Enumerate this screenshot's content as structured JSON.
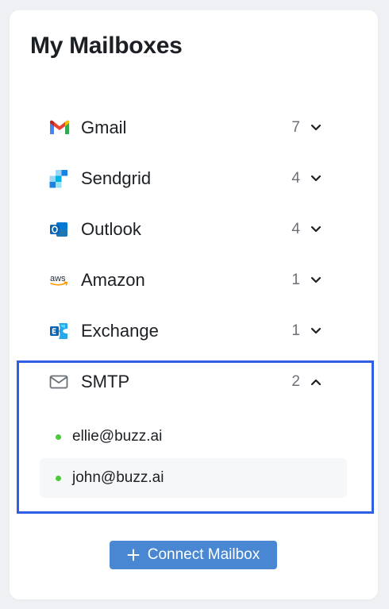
{
  "title": "My Mailboxes",
  "mailboxes": [
    {
      "label": "Gmail",
      "count": "7",
      "icon": "gmail-icon",
      "expanded": false
    },
    {
      "label": "Sendgrid",
      "count": "4",
      "icon": "sendgrid-icon",
      "expanded": false
    },
    {
      "label": "Outlook",
      "count": "4",
      "icon": "outlook-icon",
      "expanded": false
    },
    {
      "label": "Amazon",
      "count": "1",
      "icon": "aws-icon",
      "expanded": false
    },
    {
      "label": "Exchange",
      "count": "1",
      "icon": "exchange-icon",
      "expanded": false
    },
    {
      "label": "SMTP",
      "count": "2",
      "icon": "mail-envelope-icon",
      "expanded": true
    }
  ],
  "smtp_accounts": [
    {
      "email": "ellie@buzz.ai",
      "status_color": "#4cc93c"
    },
    {
      "email": "john@buzz.ai",
      "status_color": "#4cc93c"
    }
  ],
  "connect_button": {
    "label": "Connect Mailbox"
  },
  "colors": {
    "accent": "#4a87d3",
    "highlight_border": "#2f5fe4",
    "status_active": "#4cc93c"
  },
  "aws_icon_text": "aws"
}
